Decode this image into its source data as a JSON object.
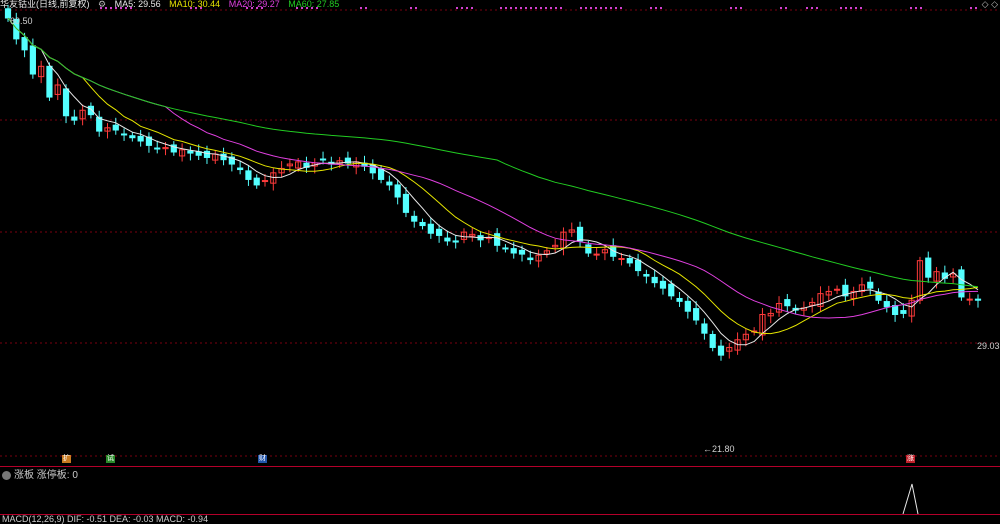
{
  "header": {
    "stock_title": "华友钴业(日线,前复权)",
    "ma_labels": [
      {
        "text": "MA5: 29.56",
        "color": "#e8e8e8"
      },
      {
        "text": "MA10: 30.44",
        "color": "#e6e600"
      },
      {
        "text": "MA20: 29.27",
        "color": "#e040e0"
      },
      {
        "text": "MA60: 27.85",
        "color": "#22cc22"
      }
    ]
  },
  "annotations": {
    "high_label": "60.50",
    "low_label": "←21.80",
    "last_price_label": "29.03"
  },
  "event_markers": [
    {
      "label": "扩",
      "color": "#c87a20"
    },
    {
      "label": "试",
      "color": "#2a8a2a"
    },
    {
      "label": "财",
      "color": "#2255aa"
    },
    {
      "label": "涨",
      "color": "#c0202a"
    }
  ],
  "sub_panel": {
    "title": "涨板",
    "subtitle": "涨停板: 0"
  },
  "macd_panel": {
    "text": "MACD(12,26,9) DIF: -0.51 DEA: -0.03 MACD: -0.94"
  },
  "colors": {
    "up": "#ff3b3b",
    "down": "#54ffff",
    "ma5": "#e8e8e8",
    "ma10": "#e6e600",
    "ma20": "#e040e0",
    "ma60": "#22cc22",
    "grid": "#7a0010",
    "dots": "#d040d0"
  },
  "chart_data": {
    "type": "candlestick",
    "title": "华友钴业(日线,前复权)",
    "ylim": [
      21.8,
      60.5
    ],
    "close": [
      60.5,
      58.6,
      57.6,
      55.4,
      56.1,
      53.3,
      54.4,
      51.6,
      51.2,
      52.1,
      51.7,
      50.2,
      50.5,
      50.3,
      49.9,
      49.6,
      49.3,
      48.9,
      48.6,
      48.7,
      48.3,
      48.5,
      48.2,
      48.0,
      47.8,
      48.1,
      47.6,
      47.2,
      46.7,
      45.8,
      45.3,
      45.7,
      46.4,
      46.8,
      47.2,
      47.4,
      46.9,
      47.3,
      47.6,
      47.2,
      47.5,
      47.3,
      47.4,
      47.0,
      46.4,
      45.8,
      45.3,
      44.2,
      42.8,
      42.0,
      41.6,
      40.9,
      40.7,
      40.2,
      40.1,
      41.0,
      40.8,
      40.3,
      40.5,
      39.8,
      39.5,
      39.1,
      39.0,
      38.5,
      38.9,
      39.3,
      39.8,
      41.0,
      41.2,
      40.2,
      39.1,
      39.0,
      39.4,
      38.8,
      38.6,
      38.2,
      37.5,
      37.0,
      36.4,
      35.9,
      35.2,
      34.7,
      33.8,
      33.0,
      31.8,
      30.5,
      29.8,
      30.5,
      31.2,
      31.7,
      32.0,
      33.5,
      33.6,
      34.5,
      34.3,
      33.9,
      34.1,
      34.6,
      35.4,
      35.6,
      35.8,
      35.2,
      35.6,
      36.2,
      35.9,
      34.8,
      34.2,
      33.5,
      33.6,
      34.8,
      38.4,
      36.9,
      37.4,
      36.8,
      37.2,
      35.1,
      34.9,
      34.8
    ],
    "ma_values": {
      "MA5": 29.56,
      "MA10": 30.44,
      "MA20": 29.27,
      "MA60": 27.85
    },
    "annotations": {
      "high": 60.5,
      "low": 21.8,
      "last": 29.03
    }
  }
}
